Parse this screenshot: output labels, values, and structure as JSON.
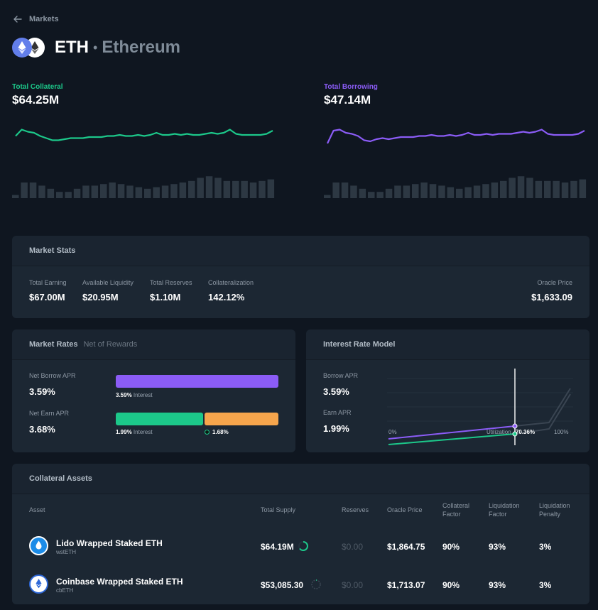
{
  "nav": {
    "back_label": "Markets"
  },
  "header": {
    "symbol": "ETH",
    "separator": "•",
    "name": "Ethereum"
  },
  "summary": {
    "collateral": {
      "label": "Total Collateral",
      "value": "$64.25M",
      "color": "#1cc88a"
    },
    "borrowing": {
      "label": "Total Borrowing",
      "value": "$47.14M",
      "color": "#8b5cf6"
    }
  },
  "market_stats": {
    "title": "Market Stats",
    "items": [
      {
        "label": "Total Earning",
        "value": "$67.00M"
      },
      {
        "label": "Available Liquidity",
        "value": "$20.95M"
      },
      {
        "label": "Total Reserves",
        "value": "$1.10M"
      },
      {
        "label": "Collateralization",
        "value": "142.12%"
      }
    ],
    "oracle": {
      "label": "Oracle Price",
      "value": "$1,633.09"
    }
  },
  "market_rates": {
    "title": "Market Rates",
    "subtitle": "Net of Rewards",
    "borrow": {
      "label": "Net Borrow APR",
      "value": "3.59%",
      "bar_value": "3.59%",
      "bar_suffix": "Interest"
    },
    "earn": {
      "label": "Net Earn APR",
      "value": "3.68%",
      "interest_value": "1.99%",
      "interest_suffix": "Interest",
      "reward_value": "1.68%"
    }
  },
  "interest_model": {
    "title": "Interest Rate Model",
    "borrow": {
      "label": "Borrow APR",
      "value": "3.59%"
    },
    "earn": {
      "label": "Earn APR",
      "value": "1.99%"
    },
    "axis_start": "0%",
    "axis_end": "100%",
    "utilization_label": "Utilization",
    "utilization_value": "70.36%",
    "utilization": 0.7036
  },
  "collateral_assets": {
    "title": "Collateral Assets",
    "columns": [
      "Asset",
      "Total Supply",
      "Reserves",
      "Oracle Price",
      "Collateral Factor",
      "Liquidation Factor",
      "Liquidation Penalty"
    ],
    "rows": [
      {
        "name": "Lido Wrapped Staked ETH",
        "symbol": "wstETH",
        "supply": "$64.19M",
        "reserves": "$0.00",
        "price": "$1,864.75",
        "cf": "90%",
        "lf": "93%",
        "lp": "3%",
        "icon_color": "#1c8ce8",
        "supply_fraction": 0.65
      },
      {
        "name": "Coinbase Wrapped Staked ETH",
        "symbol": "cbETH",
        "supply": "$53,085.30",
        "reserves": "$0.00",
        "price": "$1,713.07",
        "cf": "90%",
        "lf": "93%",
        "lp": "3%",
        "icon_color": "#2e68d8",
        "supply_fraction": 0.02
      }
    ]
  },
  "sparklines": {
    "collateral_line": [
      0.55,
      0.85,
      0.75,
      0.7,
      0.55,
      0.45,
      0.35,
      0.35,
      0.4,
      0.45,
      0.45,
      0.45,
      0.5,
      0.5,
      0.5,
      0.55,
      0.55,
      0.6,
      0.55,
      0.55,
      0.6,
      0.55,
      0.6,
      0.7,
      0.6,
      0.6,
      0.65,
      0.6,
      0.65,
      0.6,
      0.6,
      0.65,
      0.7,
      0.65,
      0.7,
      0.85,
      0.65,
      0.6,
      0.6,
      0.6,
      0.6,
      0.65,
      0.8
    ],
    "collateral_bars": [
      0.1,
      0.5,
      0.5,
      0.4,
      0.3,
      0.2,
      0.2,
      0.3,
      0.4,
      0.4,
      0.45,
      0.5,
      0.45,
      0.4,
      0.35,
      0.3,
      0.35,
      0.4,
      0.45,
      0.5,
      0.55,
      0.65,
      0.7,
      0.65,
      0.55,
      0.55,
      0.55,
      0.5,
      0.55,
      0.6,
      0.55
    ],
    "borrowing_line": [
      0.2,
      0.8,
      0.85,
      0.7,
      0.65,
      0.55,
      0.35,
      0.3,
      0.4,
      0.45,
      0.4,
      0.45,
      0.5,
      0.5,
      0.5,
      0.55,
      0.55,
      0.6,
      0.55,
      0.55,
      0.6,
      0.55,
      0.6,
      0.7,
      0.6,
      0.6,
      0.65,
      0.6,
      0.65,
      0.65,
      0.65,
      0.7,
      0.75,
      0.7,
      0.75,
      0.85,
      0.65,
      0.6,
      0.6,
      0.6,
      0.6,
      0.65,
      0.8
    ],
    "borrowing_bars": [
      0.1,
      0.5,
      0.5,
      0.4,
      0.3,
      0.2,
      0.2,
      0.3,
      0.4,
      0.4,
      0.45,
      0.5,
      0.45,
      0.4,
      0.35,
      0.3,
      0.35,
      0.4,
      0.45,
      0.5,
      0.55,
      0.65,
      0.7,
      0.65,
      0.55,
      0.55,
      0.55,
      0.5,
      0.55,
      0.6,
      0.55
    ]
  },
  "colors": {
    "background": "#0f1620",
    "card": "#1a2430",
    "green": "#1cc88a",
    "purple": "#8b5cf6",
    "orange": "#f6a54c"
  }
}
